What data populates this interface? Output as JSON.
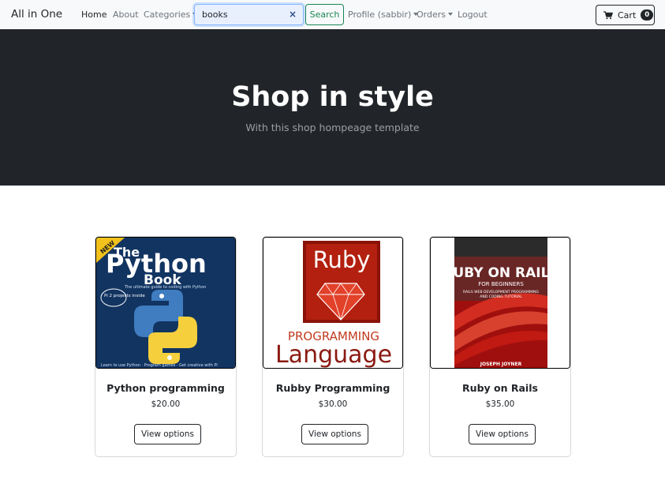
{
  "navbar": {
    "brand": "All in One",
    "links": {
      "home": "Home",
      "about": "About",
      "categories": "Categories",
      "profile": "Profile (sabbir)",
      "orders": "Orders",
      "logout": "Logout"
    },
    "search": {
      "value": "books",
      "clear_icon": "×",
      "button_label": "Search"
    },
    "cart": {
      "label": "Cart",
      "count": "0"
    }
  },
  "hero": {
    "title": "Shop in style",
    "subtitle": "With this shop hompeage template"
  },
  "products": [
    {
      "name": "Python programming",
      "price": "$20.00",
      "button": "View options",
      "cover": {
        "badge": "NEW",
        "line1": "The",
        "line2": "Python",
        "line3": "Book",
        "tagline": "The ultimate guide to coding with Python",
        "pi_note": "Pi 2 projects inside",
        "footer": "Learn to use Python · Program games · Get creative with Pi"
      }
    },
    {
      "name": "Rubby Programming",
      "price": "$30.00",
      "button": "View options",
      "cover": {
        "line1": "Ruby",
        "line2": "PROGRAMMING",
        "line3": "Language"
      }
    },
    {
      "name": "Ruby on Rails",
      "price": "$35.00",
      "button": "View options",
      "cover": {
        "line1": "RUBY ON RAILS",
        "line2": "FOR BEGINNERS",
        "line3": "RAILS WEB DEVELOPMENT PROGRAMMING",
        "line4": "AND CODING TUTORIAL",
        "author": "JOSEPH JOYNER"
      }
    }
  ],
  "colors": {
    "navbar_bg": "#f8f9fa",
    "hero_bg": "#212529",
    "search_button": "#198754",
    "search_focus": "#86b7fe"
  }
}
